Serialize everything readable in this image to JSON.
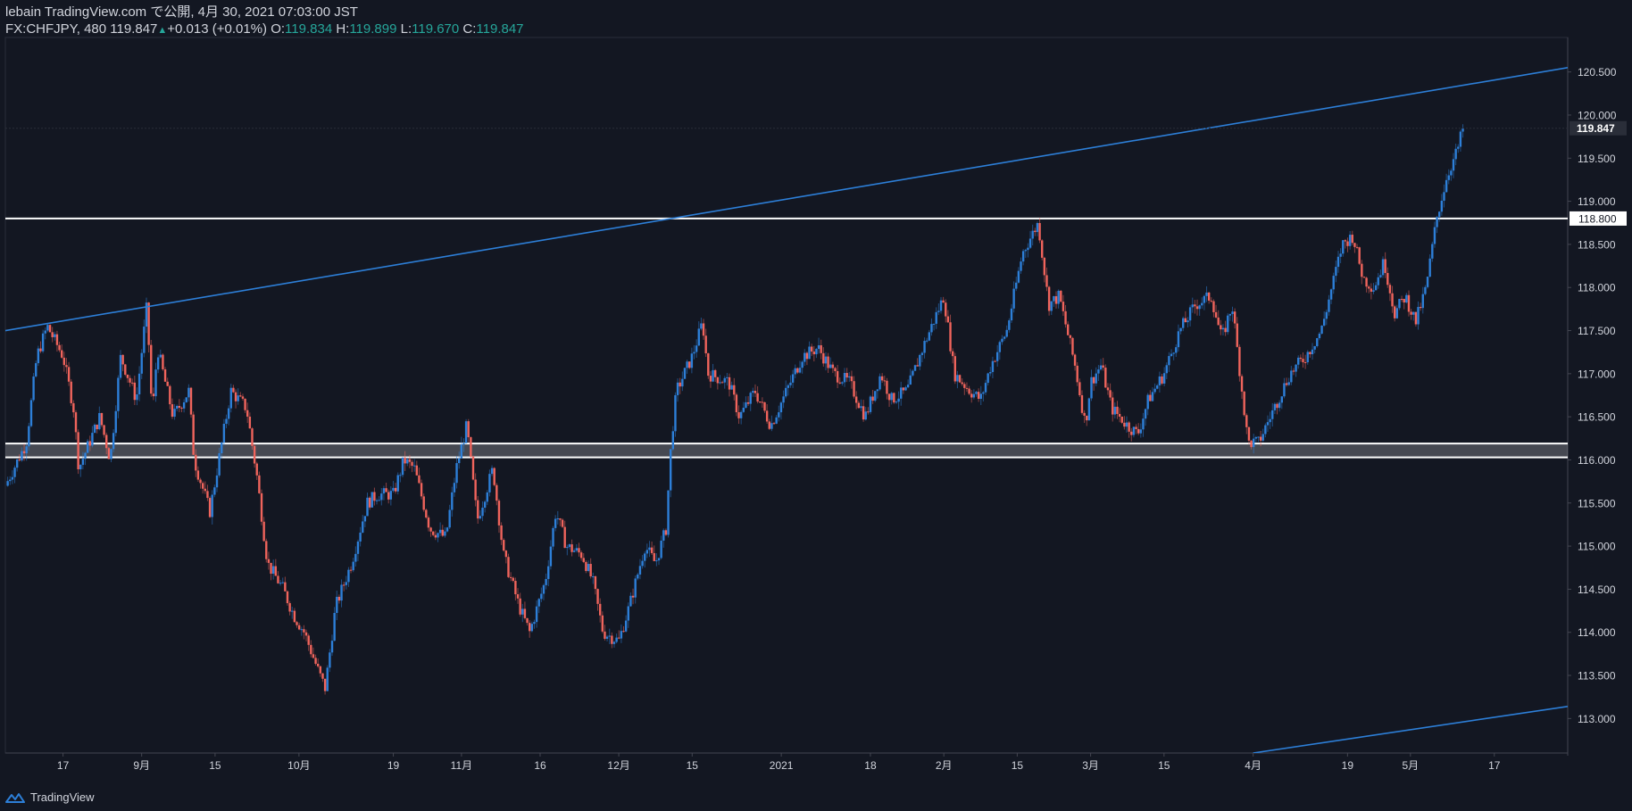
{
  "header": {
    "publisher": "lebain TradingView.com で公開, 4月 30, 2021 07:03:00 JST",
    "symbol": "FX:CHFJPY, 480",
    "last": "119.847",
    "change": "+0.013 (+0.01%)",
    "o_label": "O:",
    "o_value": "119.834",
    "h_label": "H:",
    "h_value": "119.899",
    "l_label": "L:",
    "l_value": "119.670",
    "c_label": "C:",
    "c_value": "119.847"
  },
  "footer": {
    "brand": "TradingView",
    "logo_icon": "tradingview-logo-icon"
  },
  "colors": {
    "background": "#131722",
    "up": "#2d7fd8",
    "down": "#f0645c",
    "trend": "#2d7fd8",
    "level": "#ffffff",
    "text": "#d1d4dc"
  },
  "chart_data": {
    "type": "candlestick",
    "ylim": [
      112.6,
      120.9
    ],
    "y_ticks": [
      "113.000",
      "113.500",
      "114.000",
      "114.500",
      "115.000",
      "115.500",
      "116.000",
      "116.500",
      "117.000",
      "117.500",
      "118.000",
      "118.500",
      "119.000",
      "119.500",
      "120.000",
      "120.500"
    ],
    "x_ticks": [
      "17",
      "9月",
      "15",
      "10月",
      "19",
      "11月",
      "16",
      "12月",
      "15",
      "2021",
      "18",
      "2月",
      "15",
      "3月",
      "15",
      "4月",
      "19",
      "5月",
      "17"
    ],
    "price_labels": {
      "last": "119.847",
      "level": "118.800"
    },
    "horizontal_levels": [
      118.8,
      116.19,
      116.03
    ],
    "zone": [
      116.03,
      116.19
    ],
    "trendlines": [
      {
        "name": "",
        "from": [
          "2020-08-06",
          117.5
        ],
        "to": [
          "2021-05-31",
          120.55
        ]
      },
      {
        "name": "",
        "from": [
          "2021-04-01",
          112.6
        ],
        "to": [
          "2021-05-31",
          113.14
        ]
      }
    ],
    "path": [
      [
        "2020-08-06",
        115.7
      ],
      [
        "2020-08-10",
        116.2
      ],
      [
        "2020-08-12",
        117.2
      ],
      [
        "2020-08-14",
        117.55
      ],
      [
        "2020-08-17",
        117.2
      ],
      [
        "2020-08-19",
        116.6
      ],
      [
        "2020-08-20",
        115.9
      ],
      [
        "2020-08-24",
        116.5
      ],
      [
        "2020-08-26",
        116.0
      ],
      [
        "2020-08-28",
        117.2
      ],
      [
        "2020-08-31",
        116.7
      ],
      [
        "2020-09-02",
        117.8
      ],
      [
        "2020-09-03",
        116.5
      ],
      [
        "2020-09-04",
        117.3
      ],
      [
        "2020-09-07",
        116.5
      ],
      [
        "2020-09-10",
        116.8
      ],
      [
        "2020-09-11",
        116.0
      ],
      [
        "2020-09-14",
        115.4
      ],
      [
        "2020-09-16",
        116.1
      ],
      [
        "2020-09-18",
        116.8
      ],
      [
        "2020-09-21",
        116.6
      ],
      [
        "2020-09-23",
        115.8
      ],
      [
        "2020-09-25",
        114.8
      ],
      [
        "2020-09-28",
        114.5
      ],
      [
        "2020-09-30",
        114.2
      ],
      [
        "2020-10-02",
        114.0
      ],
      [
        "2020-10-05",
        113.5
      ],
      [
        "2020-10-06",
        113.35
      ],
      [
        "2020-10-08",
        114.3
      ],
      [
        "2020-10-11",
        114.8
      ],
      [
        "2020-10-14",
        115.5
      ],
      [
        "2020-10-16",
        115.6
      ],
      [
        "2020-10-19",
        115.6
      ],
      [
        "2020-10-21",
        116.0
      ],
      [
        "2020-10-23",
        115.9
      ],
      [
        "2020-10-26",
        115.2
      ],
      [
        "2020-10-29",
        115.1
      ],
      [
        "2020-10-31",
        115.9
      ],
      [
        "2020-11-02",
        116.4
      ],
      [
        "2020-11-04",
        115.3
      ],
      [
        "2020-11-07",
        115.9
      ],
      [
        "2020-11-09",
        114.9
      ],
      [
        "2020-11-12",
        114.3
      ],
      [
        "2020-11-14",
        114.0
      ],
      [
        "2020-11-17",
        114.6
      ],
      [
        "2020-11-19",
        115.4
      ],
      [
        "2020-11-21",
        115.0
      ],
      [
        "2020-11-24",
        114.9
      ],
      [
        "2020-11-26",
        114.6
      ],
      [
        "2020-11-28",
        114.0
      ],
      [
        "2020-12-01",
        113.9
      ],
      [
        "2020-12-03",
        114.3
      ],
      [
        "2020-12-06",
        115.0
      ],
      [
        "2020-12-08",
        114.8
      ],
      [
        "2020-12-10",
        115.2
      ],
      [
        "2020-12-11",
        116.2
      ],
      [
        "2020-12-12",
        116.8
      ],
      [
        "2020-12-15",
        117.2
      ],
      [
        "2020-12-17",
        117.6
      ],
      [
        "2020-12-18",
        117.0
      ],
      [
        "2020-12-22",
        116.9
      ],
      [
        "2020-12-24",
        116.5
      ],
      [
        "2020-12-27",
        116.8
      ],
      [
        "2020-12-30",
        116.4
      ],
      [
        "2021-01-02",
        116.8
      ],
      [
        "2021-01-05",
        117.2
      ],
      [
        "2021-01-08",
        117.3
      ],
      [
        "2021-01-11",
        117.0
      ],
      [
        "2021-01-14",
        116.9
      ],
      [
        "2021-01-17",
        116.5
      ],
      [
        "2021-01-20",
        117.0
      ],
      [
        "2021-01-22",
        116.7
      ],
      [
        "2021-01-25",
        116.8
      ],
      [
        "2021-01-28",
        117.3
      ],
      [
        "2021-02-01",
        117.9
      ],
      [
        "2021-02-03",
        117.0
      ],
      [
        "2021-02-06",
        116.8
      ],
      [
        "2021-02-08",
        116.7
      ],
      [
        "2021-02-10",
        117.1
      ],
      [
        "2021-02-13",
        117.5
      ],
      [
        "2021-02-16",
        118.4
      ],
      [
        "2021-02-19",
        118.75
      ],
      [
        "2021-02-21",
        117.8
      ],
      [
        "2021-02-23",
        117.9
      ],
      [
        "2021-02-26",
        117.1
      ],
      [
        "2021-02-28",
        116.4
      ],
      [
        "2021-03-01",
        116.9
      ],
      [
        "2021-03-03",
        117.1
      ],
      [
        "2021-03-05",
        116.6
      ],
      [
        "2021-03-08",
        116.4
      ],
      [
        "2021-03-10",
        116.3
      ],
      [
        "2021-03-12",
        116.7
      ],
      [
        "2021-03-15",
        117.0
      ],
      [
        "2021-03-18",
        117.5
      ],
      [
        "2021-03-21",
        117.8
      ],
      [
        "2021-03-24",
        117.9
      ],
      [
        "2021-03-26",
        117.4
      ],
      [
        "2021-03-28",
        117.8
      ],
      [
        "2021-03-31",
        116.2
      ],
      [
        "2021-04-02",
        116.2
      ],
      [
        "2021-04-05",
        116.6
      ],
      [
        "2021-04-08",
        117.0
      ],
      [
        "2021-04-11",
        117.2
      ],
      [
        "2021-04-14",
        117.5
      ],
      [
        "2021-04-16",
        118.0
      ],
      [
        "2021-04-18",
        118.5
      ],
      [
        "2021-04-20",
        118.6
      ],
      [
        "2021-04-22",
        118.1
      ],
      [
        "2021-04-24",
        118.0
      ],
      [
        "2021-04-26",
        118.3
      ],
      [
        "2021-04-28",
        117.7
      ],
      [
        "2021-04-30",
        117.9
      ],
      [
        "2021-05-02",
        117.6
      ],
      [
        "2021-05-04",
        118.0
      ],
      [
        "2021-05-06",
        118.8
      ],
      [
        "2021-05-08",
        119.3
      ],
      [
        "2021-05-10",
        119.6
      ],
      [
        "2021-05-11",
        119.847
      ]
    ]
  }
}
